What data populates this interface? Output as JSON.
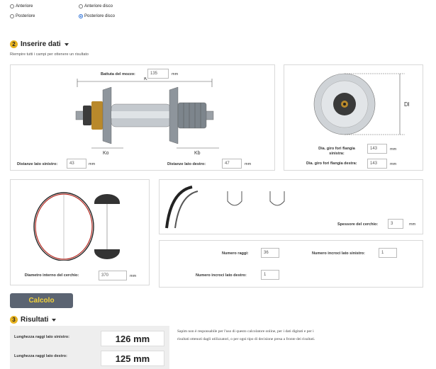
{
  "hub_options": {
    "anteriore": "Anteriore",
    "anteriore_disco": "Anteriore disco",
    "posteriore": "Posteriore",
    "posteriore_disco": "Posteriore disco",
    "selected": "posteriore_disco"
  },
  "section2": {
    "number": "2",
    "title": "Inserire dati",
    "subtitle": "Riempire tutti i campi per ottenere un risultato"
  },
  "hub_panel": {
    "battuta_label": "Battuta del mozzo:",
    "battuta_value": "135",
    "battuta_unit": "mm",
    "k_label": "K",
    "ko_label": "Ko",
    "kb_label": "Kb",
    "left_label": "Distanze lato sinistro:",
    "left_value": "43",
    "left_unit": "mm",
    "right_label": "Distanze lato destro:",
    "right_value": "47",
    "right_unit": "mm"
  },
  "flange_panel": {
    "dl_label": "Dl",
    "left_label": "Dia. giro fori flangia sinistra:",
    "left_value": "143",
    "left_unit": "mm",
    "right_label": "Dia. giro fori flangia destra:",
    "right_value": "143",
    "right_unit": "mm"
  },
  "rim_panel": {
    "diam_label": "Diametro interno del cerchio:",
    "diam_value": "370",
    "diam_unit": "mm"
  },
  "rim_profile_panel": {
    "thickness_label": "Spessore del cerchio:",
    "thickness_value": "3",
    "thickness_unit": "mm"
  },
  "spokes_panel": {
    "spokes_label": "Numero raggi:",
    "spokes_value": "36",
    "cross_left_label": "Numero incroci lato sinistro:",
    "cross_left_value": "1",
    "cross_right_label": "Numero incroci lato destro:",
    "cross_right_value": "1"
  },
  "calc_button": "Calcolo",
  "section3": {
    "number": "3",
    "title": "Risultati"
  },
  "results": {
    "left_label": "Lunghezza raggi lato sinistro:",
    "left_value": "126 mm",
    "right_label": "Lunghezza raggi lato destro:",
    "right_value": "125 mm"
  },
  "disclaimer": "Sapim non è responsabile per l'uso di questo calcolatore online, per i dati digitati e per i risultati ottenuti dagli utilizzatori, o per ogni tipo di decisione presa a fronte dei risultati.",
  "colors": {
    "accent": "#e7b321",
    "button_bg": "#5b6472",
    "button_text": "#f3d23a",
    "rim_red": "#b3261e"
  }
}
